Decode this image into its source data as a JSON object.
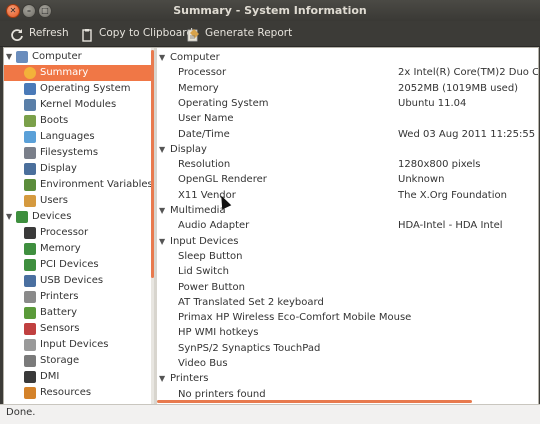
{
  "window": {
    "title": "Summary - System Information"
  },
  "toolbar": {
    "refresh": "Refresh",
    "copy": "Copy to Clipboard",
    "report": "Generate Report"
  },
  "tree": [
    {
      "label": "Computer",
      "kind": "category",
      "icon": "computer-icon",
      "color": "#6a8dbd"
    },
    {
      "label": "Summary",
      "kind": "item",
      "icon": "info-icon",
      "color": "#f3b23a",
      "selected": true
    },
    {
      "label": "Operating System",
      "kind": "item",
      "icon": "os-icon",
      "color": "#4a7ab8"
    },
    {
      "label": "Kernel Modules",
      "kind": "item",
      "icon": "module-icon",
      "color": "#5a7fa8"
    },
    {
      "label": "Boots",
      "kind": "item",
      "icon": "boots-icon",
      "color": "#7aa04a"
    },
    {
      "label": "Languages",
      "kind": "item",
      "icon": "language-icon",
      "color": "#5aa0d8"
    },
    {
      "label": "Filesystems",
      "kind": "item",
      "icon": "filesystem-icon",
      "color": "#7a7f8a"
    },
    {
      "label": "Display",
      "kind": "item",
      "icon": "display-icon",
      "color": "#4b6f9c"
    },
    {
      "label": "Environment Variables",
      "kind": "item",
      "icon": "env-icon",
      "color": "#5b8d3b"
    },
    {
      "label": "Users",
      "kind": "item",
      "icon": "users-icon",
      "color": "#d59a3f"
    },
    {
      "label": "Devices",
      "kind": "category",
      "icon": "devices-icon",
      "color": "#3e8f3e"
    },
    {
      "label": "Processor",
      "kind": "item",
      "icon": "processor-icon",
      "color": "#3a3a3a"
    },
    {
      "label": "Memory",
      "kind": "item",
      "icon": "memory-icon",
      "color": "#3f8f3f"
    },
    {
      "label": "PCI Devices",
      "kind": "item",
      "icon": "pci-icon",
      "color": "#3f8f3f"
    },
    {
      "label": "USB Devices",
      "kind": "item",
      "icon": "usb-icon",
      "color": "#4a6fa0"
    },
    {
      "label": "Printers",
      "kind": "item",
      "icon": "printer-icon",
      "color": "#8a8a8a"
    },
    {
      "label": "Battery",
      "kind": "item",
      "icon": "battery-icon",
      "color": "#5a9a3a"
    },
    {
      "label": "Sensors",
      "kind": "item",
      "icon": "sensors-icon",
      "color": "#c04040"
    },
    {
      "label": "Input Devices",
      "kind": "item",
      "icon": "input-icon",
      "color": "#9a9a9a"
    },
    {
      "label": "Storage",
      "kind": "item",
      "icon": "storage-icon",
      "color": "#7a7a7a"
    },
    {
      "label": "DMI",
      "kind": "item",
      "icon": "dmi-icon",
      "color": "#3a3a3a"
    },
    {
      "label": "Resources",
      "kind": "item",
      "icon": "resources-icon",
      "color": "#d4822a"
    }
  ],
  "details": [
    {
      "type": "category",
      "label": "Computer"
    },
    {
      "type": "row",
      "key": "Processor",
      "value": "2x Intel(R) Core(TM)2 Duo CPU"
    },
    {
      "type": "row",
      "key": "Memory",
      "value": "2052MB (1019MB used)"
    },
    {
      "type": "row",
      "key": "Operating System",
      "value": "Ubuntu 11.04"
    },
    {
      "type": "row",
      "key": "User Name",
      "value": ""
    },
    {
      "type": "row",
      "key": "Date/Time",
      "value": "Wed 03 Aug 2011 11:25:55 AM ID"
    },
    {
      "type": "category",
      "label": "Display"
    },
    {
      "type": "row",
      "key": "Resolution",
      "value": "1280x800 pixels"
    },
    {
      "type": "row",
      "key": "OpenGL Renderer",
      "value": "Unknown"
    },
    {
      "type": "row",
      "key": "X11 Vendor",
      "value": "The X.Org Foundation"
    },
    {
      "type": "category",
      "label": "Multimedia"
    },
    {
      "type": "row",
      "key": "Audio Adapter",
      "value": "HDA-Intel - HDA Intel"
    },
    {
      "type": "category",
      "label": "Input Devices"
    },
    {
      "type": "row",
      "key": "Sleep Button",
      "value": ""
    },
    {
      "type": "row",
      "key": "Lid Switch",
      "value": ""
    },
    {
      "type": "row",
      "key": "Power Button",
      "value": ""
    },
    {
      "type": "row",
      "key": "AT Translated Set 2 keyboard",
      "value": ""
    },
    {
      "type": "row",
      "key": "Primax HP Wireless Eco-Comfort Mobile Mouse",
      "value": ""
    },
    {
      "type": "row",
      "key": "HP WMI hotkeys",
      "value": ""
    },
    {
      "type": "row",
      "key": "SynPS/2 Synaptics TouchPad",
      "value": ""
    },
    {
      "type": "row",
      "key": "Video Bus",
      "value": ""
    },
    {
      "type": "category",
      "label": "Printers"
    },
    {
      "type": "row",
      "key": "No printers found",
      "value": ""
    }
  ],
  "status": "Done.",
  "colors": {
    "selection": "#f07746",
    "accent": "#e87a4e",
    "titlebar": "#3c3b37"
  }
}
